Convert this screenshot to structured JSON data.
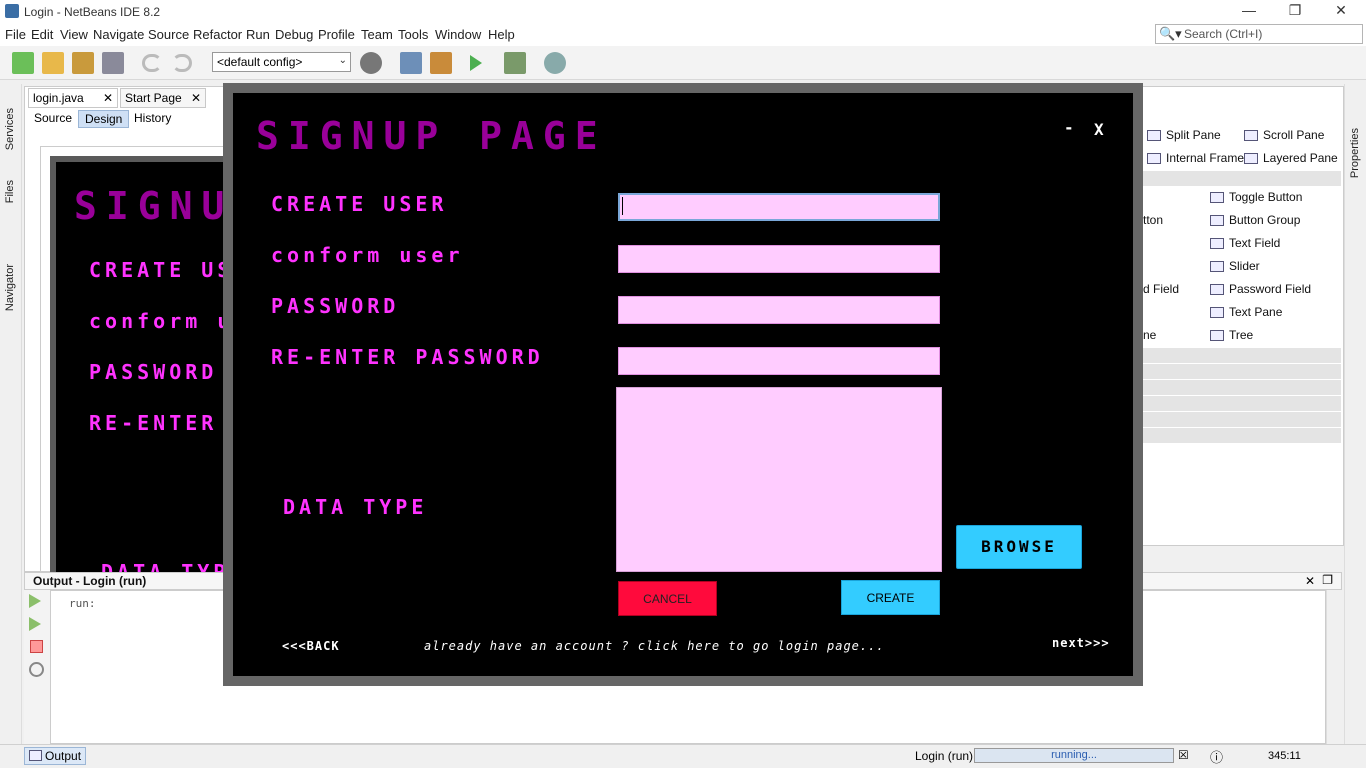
{
  "window": {
    "title": "Login - NetBeans IDE 8.2",
    "minimize": "—",
    "restore": "❐",
    "close": "✕"
  },
  "menu": [
    "File",
    "Edit",
    "View",
    "Navigate",
    "Source",
    "Refactor",
    "Run",
    "Debug",
    "Profile",
    "Team",
    "Tools",
    "Window",
    "Help"
  ],
  "search": {
    "placeholder": "Search (Ctrl+I)"
  },
  "toolbar": {
    "config": "<default config>"
  },
  "left_strip": {
    "services": "Services",
    "files": "Files",
    "navigator": "Navigator"
  },
  "right_strip": {
    "properties": "Properties"
  },
  "editor": {
    "tabs": [
      "login.java",
      "Start Page"
    ],
    "modes": [
      "Source",
      "Design",
      "History"
    ],
    "background_form": {
      "title": "SIGNU",
      "labels": [
        "CREATE US",
        "conform u",
        "PASSWORD",
        "RE-ENTER",
        "DATA TYP"
      ]
    }
  },
  "palette": {
    "items": [
      "Split Pane",
      "Scroll Pane",
      "Internal Frame",
      "Layered Pane",
      "Toggle Button",
      "Button Group",
      "Text Field",
      "Slider",
      "Password Field",
      "Text Pane",
      "Tree"
    ],
    "partial_items": [
      "tton",
      "d Field",
      "ne"
    ]
  },
  "output": {
    "title": "Output - Login (run)",
    "run_text": "run:",
    "tab_label": "Output"
  },
  "status": {
    "task": "Login (run)",
    "progress_text": "running...",
    "position": "345:11"
  },
  "signup": {
    "title": "SIGNUP PAGE",
    "minimize": "-",
    "close": "X",
    "labels": {
      "create_user": "CREATE USER",
      "confirm_user": "conform user",
      "password": "PASSWORD",
      "reenter_password": "RE-ENTER PASSWORD",
      "data_type": "DATA TYPE"
    },
    "buttons": {
      "browse": "BROWSE",
      "cancel": "CANCEL",
      "create": "CREATE"
    },
    "footer": {
      "back": "<<<BACK",
      "login_prompt": "already have an account ? click here to go login page...",
      "next": "next>>>"
    }
  },
  "colors": {
    "accent_magenta": "#ff33ff",
    "title_purple": "#990099",
    "field_pink": "#ffccff",
    "button_cyan": "#33ccff",
    "cancel_red": "#ff0a3c"
  }
}
